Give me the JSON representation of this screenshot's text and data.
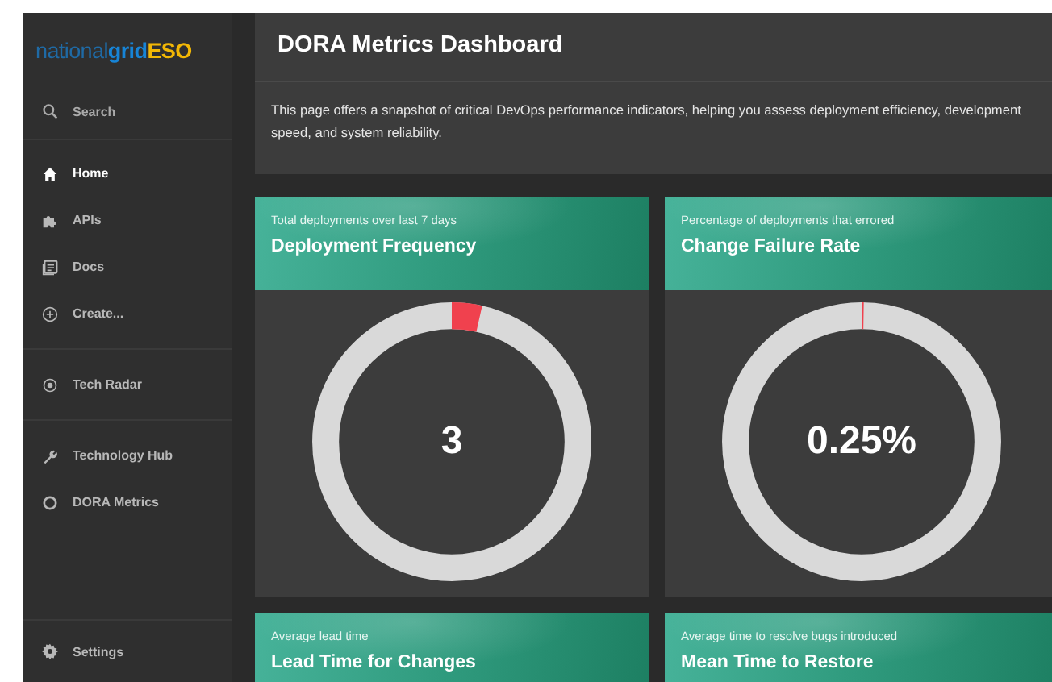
{
  "sidebar": {
    "logo": {
      "part_1": "national",
      "part_2": "grid",
      "part_3": "ESO"
    },
    "search": {
      "label": "Search"
    },
    "sections": [
      {
        "items": [
          {
            "label": "Home",
            "selected": true
          },
          {
            "label": "APIs",
            "selected": false
          },
          {
            "label": "Docs",
            "selected": false
          },
          {
            "label": "Create...",
            "selected": false
          }
        ]
      },
      {
        "items": [
          {
            "label": "Tech Radar",
            "selected": false
          }
        ]
      },
      {
        "items": [
          {
            "label": "Technology Hub",
            "selected": false
          },
          {
            "label": "DORA Metrics",
            "selected": false
          }
        ]
      }
    ],
    "settings": {
      "label": "Settings"
    }
  },
  "header": {
    "title": "DORA Metrics Dashboard",
    "description": "This page offers a snapshot of critical DevOps performance indicators, helping you assess deployment efficiency, development speed, and system reliability."
  },
  "cards": [
    {
      "subtitle": "Total deployments over last 7 days",
      "title": "Deployment Frequency",
      "value": "3",
      "level": 0.035
    },
    {
      "subtitle": "Percentage of deployments that errored",
      "title": "Change Failure Rate",
      "value": "0.25%",
      "level": 0.0025
    },
    {
      "subtitle": "Average lead time",
      "title": "Lead Time for Changes"
    },
    {
      "subtitle": "Average time to resolve bugs introduced",
      "title": "Mean Time to Restore"
    }
  ]
}
